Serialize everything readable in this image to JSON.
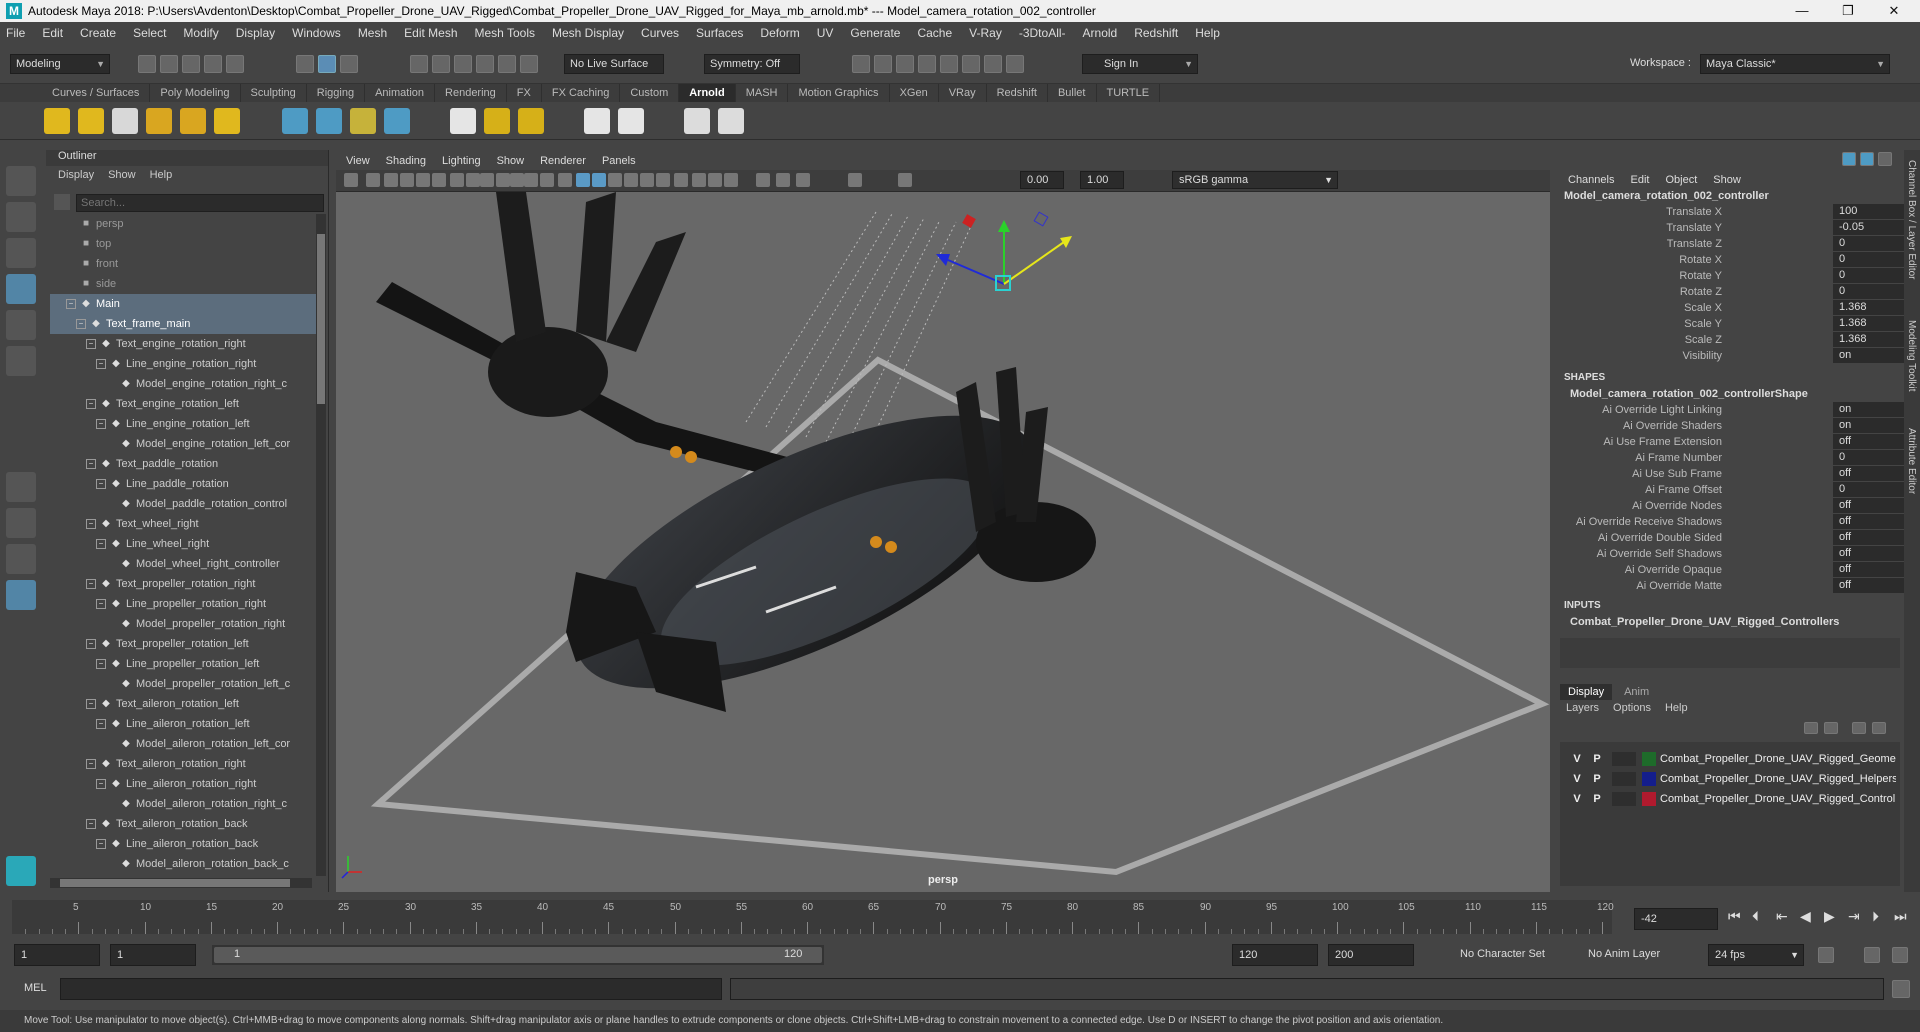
{
  "app": {
    "title": "Autodesk Maya 2018: P:\\Users\\Avdenton\\Desktop\\Combat_Propeller_Drone_UAV_Rigged\\Combat_Propeller_Drone_UAV_Rigged_for_Maya_mb_arnold.mb*   ---   Model_camera_rotation_002_controller",
    "logo": "M"
  },
  "window_controls": {
    "minimize": "—",
    "maximize": "❐",
    "close": "✕"
  },
  "menubar": [
    "File",
    "Edit",
    "Create",
    "Select",
    "Modify",
    "Display",
    "Windows",
    "Mesh",
    "Edit Mesh",
    "Mesh Tools",
    "Mesh Display",
    "Curves",
    "Surfaces",
    "Deform",
    "UV",
    "Generate",
    "Cache",
    "V-Ray",
    "-3DtoAll-",
    "Arnold",
    "Redshift",
    "Help"
  ],
  "workspace": {
    "label": "Workspace :",
    "value": "Maya Classic*"
  },
  "statusline": {
    "mode": "Modeling",
    "live_surface": "No Live Surface",
    "symmetry": "Symmetry: Off",
    "sign_in": "Sign In"
  },
  "shelf_tabs": [
    "Curves / Surfaces",
    "Poly Modeling",
    "Sculpting",
    "Rigging",
    "Animation",
    "Rendering",
    "FX",
    "FX Caching",
    "Custom",
    "Arnold",
    "MASH",
    "Motion Graphics",
    "XGen",
    "VRay",
    "Redshift",
    "Bullet",
    "TURTLE"
  ],
  "shelf_active": "Arnold",
  "outliner": {
    "title": "Outliner",
    "menu": [
      "Display",
      "Show",
      "Help"
    ],
    "search_placeholder": "Search...",
    "items": [
      {
        "label": "persp",
        "indent": 0,
        "icon": "camera",
        "dim": true
      },
      {
        "label": "top",
        "indent": 0,
        "icon": "camera",
        "dim": true
      },
      {
        "label": "front",
        "indent": 0,
        "icon": "camera",
        "dim": true
      },
      {
        "label": "side",
        "indent": 0,
        "icon": "camera",
        "dim": true
      },
      {
        "label": "Main",
        "indent": 0,
        "icon": "transform",
        "exp": "−",
        "sel": true
      },
      {
        "label": "Text_frame_main",
        "indent": 1,
        "icon": "transform",
        "exp": "−",
        "sel": true
      },
      {
        "label": "Text_engine_rotation_right",
        "indent": 2,
        "icon": "transform",
        "exp": "−"
      },
      {
        "label": "Line_engine_rotation_right",
        "indent": 3,
        "icon": "transform",
        "exp": "−"
      },
      {
        "label": "Model_engine_rotation_right_c",
        "indent": 4,
        "icon": "transform"
      },
      {
        "label": "Text_engine_rotation_left",
        "indent": 2,
        "icon": "transform",
        "exp": "−"
      },
      {
        "label": "Line_engine_rotation_left",
        "indent": 3,
        "icon": "transform",
        "exp": "−"
      },
      {
        "label": "Model_engine_rotation_left_cor",
        "indent": 4,
        "icon": "transform"
      },
      {
        "label": "Text_paddle_rotation",
        "indent": 2,
        "icon": "transform",
        "exp": "−"
      },
      {
        "label": "Line_paddle_rotation",
        "indent": 3,
        "icon": "transform",
        "exp": "−"
      },
      {
        "label": "Model_paddle_rotation_control",
        "indent": 4,
        "icon": "transform"
      },
      {
        "label": "Text_wheel_right",
        "indent": 2,
        "icon": "transform",
        "exp": "−"
      },
      {
        "label": "Line_wheel_right",
        "indent": 3,
        "icon": "transform",
        "exp": "−"
      },
      {
        "label": "Model_wheel_right_controller",
        "indent": 4,
        "icon": "transform"
      },
      {
        "label": "Text_propeller_rotation_right",
        "indent": 2,
        "icon": "transform",
        "exp": "−"
      },
      {
        "label": "Line_propeller_rotation_right",
        "indent": 3,
        "icon": "transform",
        "exp": "−"
      },
      {
        "label": "Model_propeller_rotation_right",
        "indent": 4,
        "icon": "transform"
      },
      {
        "label": "Text_propeller_rotation_left",
        "indent": 2,
        "icon": "transform",
        "exp": "−"
      },
      {
        "label": "Line_propeller_rotation_left",
        "indent": 3,
        "icon": "transform",
        "exp": "−"
      },
      {
        "label": "Model_propeller_rotation_left_c",
        "indent": 4,
        "icon": "transform"
      },
      {
        "label": "Text_aileron_rotation_left",
        "indent": 2,
        "icon": "transform",
        "exp": "−"
      },
      {
        "label": "Line_aileron_rotation_left",
        "indent": 3,
        "icon": "transform",
        "exp": "−"
      },
      {
        "label": "Model_aileron_rotation_left_cor",
        "indent": 4,
        "icon": "transform"
      },
      {
        "label": "Text_aileron_rotation_right",
        "indent": 2,
        "icon": "transform",
        "exp": "−"
      },
      {
        "label": "Line_aileron_rotation_right",
        "indent": 3,
        "icon": "transform",
        "exp": "−"
      },
      {
        "label": "Model_aileron_rotation_right_c",
        "indent": 4,
        "icon": "transform"
      },
      {
        "label": "Text_aileron_rotation_back",
        "indent": 2,
        "icon": "transform",
        "exp": "−"
      },
      {
        "label": "Line_aileron_rotation_back",
        "indent": 3,
        "icon": "transform",
        "exp": "−"
      },
      {
        "label": "Model_aileron_rotation_back_c",
        "indent": 4,
        "icon": "transform"
      }
    ]
  },
  "viewport": {
    "menu": [
      "View",
      "Shading",
      "Lighting",
      "Show",
      "Renderer",
      "Panels"
    ],
    "field_a": "0.00",
    "field_b": "1.00",
    "color_space": "sRGB gamma",
    "camera_label": "persp"
  },
  "channelbox": {
    "menu": [
      "Channels",
      "Edit",
      "Object",
      "Show"
    ],
    "object": "Model_camera_rotation_002_controller",
    "channels": [
      {
        "name": "Translate X",
        "value": "100"
      },
      {
        "name": "Translate Y",
        "value": "-0.05"
      },
      {
        "name": "Translate Z",
        "value": "0"
      },
      {
        "name": "Rotate X",
        "value": "0"
      },
      {
        "name": "Rotate Y",
        "value": "0"
      },
      {
        "name": "Rotate Z",
        "value": "0"
      },
      {
        "name": "Scale X",
        "value": "1.368"
      },
      {
        "name": "Scale Y",
        "value": "1.368"
      },
      {
        "name": "Scale Z",
        "value": "1.368"
      },
      {
        "name": "Visibility",
        "value": "on"
      }
    ],
    "shapes_label": "SHAPES",
    "shape_name": "Model_camera_rotation_002_controllerShape",
    "shape_attrs": [
      {
        "name": "Ai Override Light Linking",
        "value": "on"
      },
      {
        "name": "Ai Override Shaders",
        "value": "on"
      },
      {
        "name": "Ai Use Frame Extension",
        "value": "off"
      },
      {
        "name": "Ai Frame Number",
        "value": "0"
      },
      {
        "name": "Ai Use Sub Frame",
        "value": "off"
      },
      {
        "name": "Ai Frame Offset",
        "value": "0"
      },
      {
        "name": "Ai Override Nodes",
        "value": "off"
      },
      {
        "name": "Ai Override Receive Shadows",
        "value": "off"
      },
      {
        "name": "Ai Override Double Sided",
        "value": "off"
      },
      {
        "name": "Ai Override Self Shadows",
        "value": "off"
      },
      {
        "name": "Ai Override Opaque",
        "value": "off"
      },
      {
        "name": "Ai Override Matte",
        "value": "off"
      }
    ],
    "inputs_label": "INPUTS",
    "input_name": "Combat_Propeller_Drone_UAV_Rigged_Controllers"
  },
  "layer_editor": {
    "tabs": [
      "Display",
      "Anim"
    ],
    "menu": [
      "Layers",
      "Options",
      "Help"
    ],
    "layers": [
      {
        "v": "V",
        "p": "P",
        "color": "#1e6b2a",
        "name": "Combat_Propeller_Drone_UAV_Rigged_Geometry"
      },
      {
        "v": "V",
        "p": "P",
        "color": "#141e8c",
        "name": "Combat_Propeller_Drone_UAV_Rigged_Helpers"
      },
      {
        "v": "V",
        "p": "P",
        "color": "#b01a2e",
        "name": "Combat_Propeller_Drone_UAV_Rigged_Controllers"
      }
    ]
  },
  "side_tabs": [
    "Channel Box / Layer Editor",
    "Modeling Toolkit",
    "Attribute Editor"
  ],
  "timeline": {
    "ticks": [
      5,
      10,
      15,
      20,
      25,
      30,
      35,
      40,
      45,
      50,
      55,
      60,
      65,
      70,
      75,
      80,
      85,
      90,
      95,
      100,
      105,
      110,
      115,
      120
    ],
    "current_frame": "-42"
  },
  "range": {
    "start": "1",
    "anim_start": "1",
    "slider_start": "1",
    "slider_end": "120",
    "end": "120",
    "anim_end": "200",
    "character_set": "No Character Set",
    "anim_layer": "No Anim Layer",
    "fps": "24 fps"
  },
  "cmdline": {
    "label": "MEL"
  },
  "helpline": "Move Tool: Use manipulator to move object(s). Ctrl+MMB+drag to move components along normals. Shift+drag manipulator axis or plane handles to extrude components or clone objects. Ctrl+Shift+LMB+drag to constrain movement to a connected edge. Use D or INSERT to change the pivot position and axis orientation.",
  "colors": {
    "accent": "#5285a6",
    "selection": "#5c6d7d",
    "viewport_bg": "#686868"
  }
}
